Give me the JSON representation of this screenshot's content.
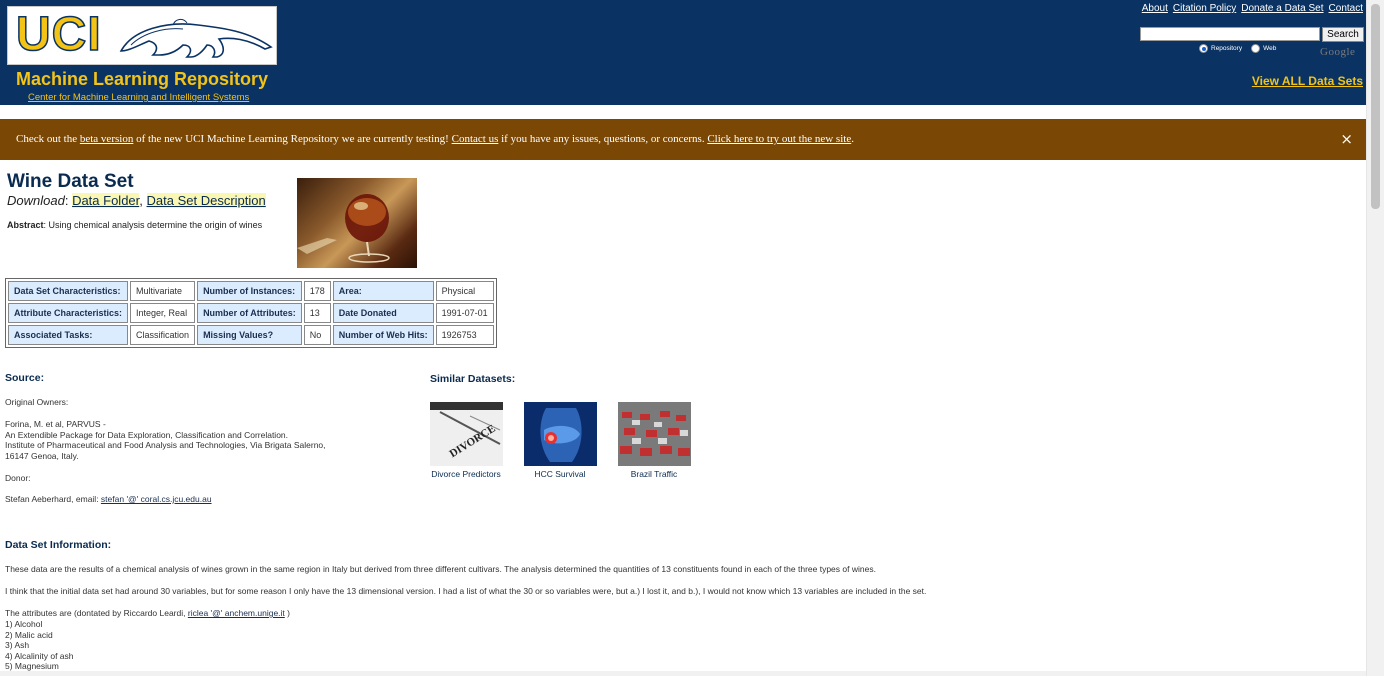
{
  "header": {
    "logo_text": "UCI",
    "title": "Machine Learning Repository",
    "subtitle": "Center for Machine Learning and Intelligent Systems",
    "top_links": [
      "About",
      "Citation Policy",
      "Donate a Data Set",
      "Contact"
    ],
    "search_button": "Search",
    "radio_repository": "Repository",
    "radio_web": "Web",
    "google_text": "Google",
    "view_all": "View ALL Data Sets"
  },
  "banner": {
    "text_1": "Check out the ",
    "link_beta": "beta version",
    "text_2": " of the new UCI Machine Learning Repository we are currently testing! ",
    "link_contact": "Contact us",
    "text_3": " if you have any issues, questions, or concerns. ",
    "link_new_site": "Click here to try out the new site",
    "text_4": ".",
    "close_glyph": "×"
  },
  "dataset": {
    "title": "Wine Data Set",
    "download_label": "Download",
    "data_folder": "Data Folder",
    "description_link": "Data Set Description",
    "abstract_label": "Abstract",
    "abstract_text": ": Using chemical analysis determine the origin of wines"
  },
  "characteristics": [
    [
      {
        "label": "Data Set Characteristics:",
        "value": "Multivariate"
      },
      {
        "label": "Number of Instances:",
        "value": "178"
      },
      {
        "label": "Area:",
        "value": "Physical"
      }
    ],
    [
      {
        "label": "Attribute Characteristics:",
        "value": "Integer, Real"
      },
      {
        "label": "Number of Attributes:",
        "value": "13"
      },
      {
        "label": "Date Donated",
        "value": "1991-07-01"
      }
    ],
    [
      {
        "label": "Associated Tasks:",
        "value": "Classification"
      },
      {
        "label": "Missing Values?",
        "value": "No"
      },
      {
        "label": "Number of Web Hits:",
        "value": "1926753"
      }
    ]
  ],
  "source": {
    "heading": "Source:",
    "original_owners": "Original Owners:",
    "owner_line_1": "Forina, M. et al, PARVUS -",
    "owner_line_2": "An Extendible Package for Data Exploration, Classification and Correlation.",
    "owner_line_3": "Institute of Pharmaceutical and Food Analysis and Technologies, Via Brigata Salerno,",
    "owner_line_4": "16147 Genoa, Italy.",
    "donor": "Donor:",
    "donor_text": "Stefan Aeberhard, email: ",
    "donor_email": "stefan '@' coral.cs.jcu.edu.au"
  },
  "similar": {
    "heading": "Similar Datasets:",
    "items": [
      "Divorce Predictors",
      "HCC Survival",
      "Brazil Traffic"
    ],
    "divorce_word": "DIVORCE"
  },
  "info": {
    "heading": "Data Set Information:",
    "para_1": "These data are the results of a chemical analysis of wines grown in the same region in Italy but derived from three different cultivars. The analysis determined the quantities of 13 constituents found in each of the three types of wines.",
    "para_2": "I think that the initial data set had around 30 variables, but for some reason I only have the 13 dimensional version. I had a list of what the 30 or so variables were, but a.) I lost it, and b.), I would not know which 13 variables are included in the set.",
    "attributes_intro": "The attributes are (dontated by Riccardo Leardi, ",
    "attributes_email": "riclea '@' anchem.unige.it",
    "attributes_close": " )",
    "attributes": [
      "1) Alcohol",
      "2) Malic acid",
      "3) Ash",
      "4) Alcalinity of ash",
      "5) Magnesium"
    ]
  }
}
